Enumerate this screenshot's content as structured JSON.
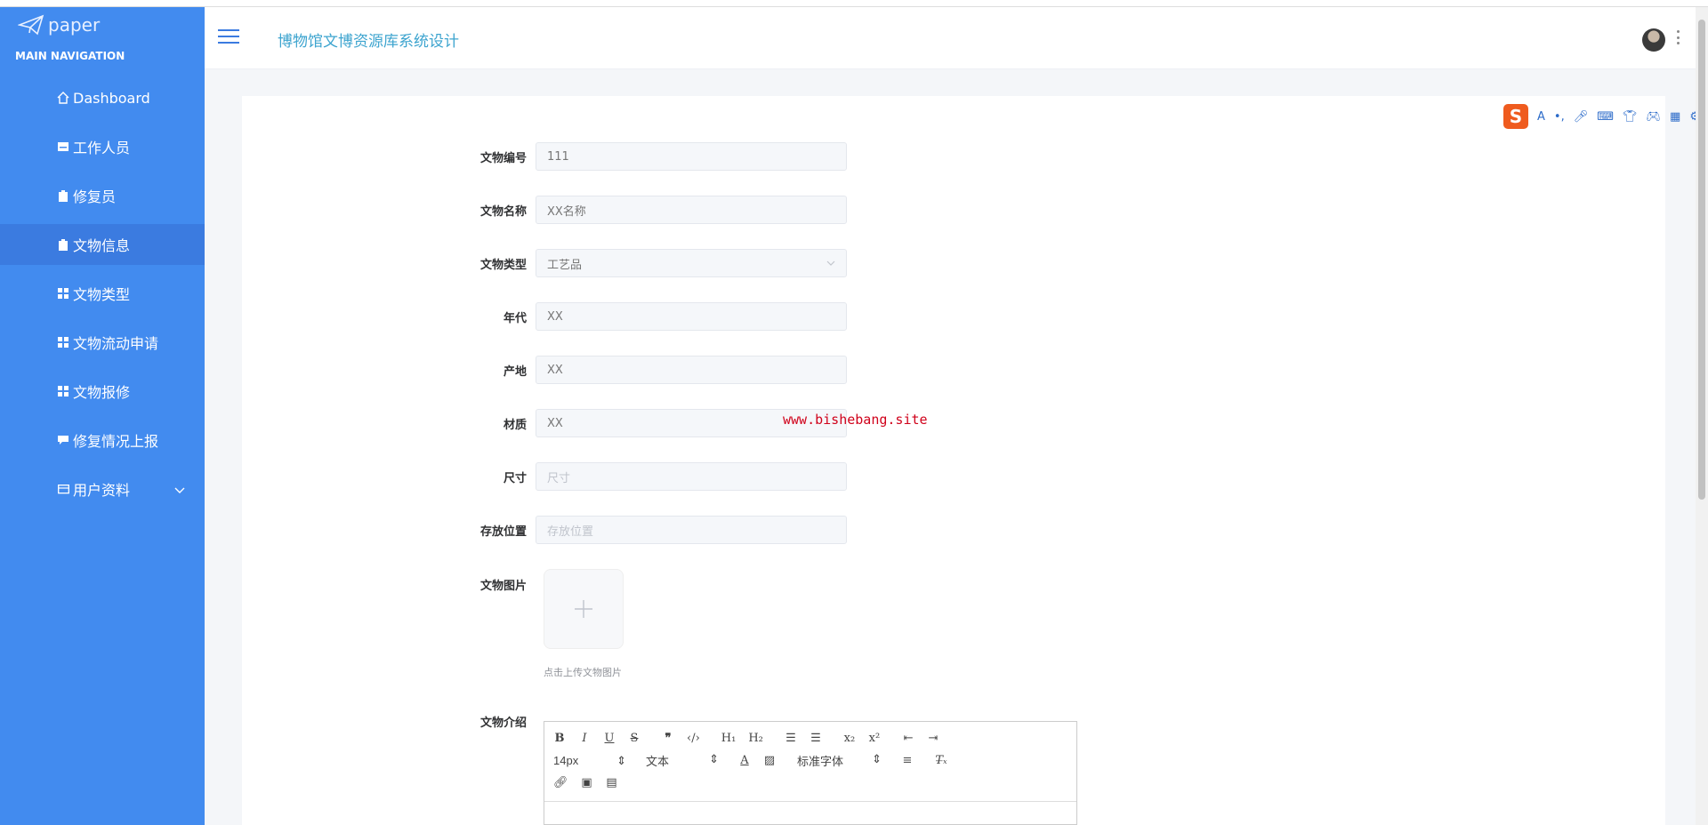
{
  "brand": {
    "logo_text": "paper"
  },
  "sidebar": {
    "header": "MAIN NAVIGATION",
    "items": [
      {
        "label": "Dashboard",
        "icon": "home-icon"
      },
      {
        "label": "工作人员",
        "icon": "card-icon"
      },
      {
        "label": "修复员",
        "icon": "clipboard-icon"
      },
      {
        "label": "文物信息",
        "icon": "clipboard-icon",
        "active": true
      },
      {
        "label": "文物类型",
        "icon": "grid-icon"
      },
      {
        "label": "文物流动申请",
        "icon": "grid-icon"
      },
      {
        "label": "文物报修",
        "icon": "grid-icon"
      },
      {
        "label": "修复情况上报",
        "icon": "comment-icon"
      },
      {
        "label": "用户资料",
        "icon": "user-card-icon"
      }
    ]
  },
  "topbar": {
    "title": "博物馆文博资源库系统设计"
  },
  "form": {
    "code": {
      "label": "文物编号",
      "value": "111"
    },
    "name": {
      "label": "文物名称",
      "value": "XX名称"
    },
    "type": {
      "label": "文物类型",
      "value": "工艺品"
    },
    "era": {
      "label": "年代",
      "value": "XX"
    },
    "origin": {
      "label": "产地",
      "value": "XX"
    },
    "material": {
      "label": "材质",
      "value": "XX"
    },
    "size": {
      "label": "尺寸",
      "placeholder": "尺寸"
    },
    "location": {
      "label": "存放位置",
      "placeholder": "存放位置"
    },
    "image": {
      "label": "文物图片",
      "hint": "点击上传文物图片"
    },
    "intro": {
      "label": "文物介绍"
    }
  },
  "editor": {
    "font_size": "14px",
    "header_select": "文本",
    "font_family": "标准字体"
  },
  "watermark": "www.bishebang.site",
  "colors": {
    "sidebar": "#428bef",
    "accent": "#3da4cf",
    "watermark": "#d0021b"
  }
}
